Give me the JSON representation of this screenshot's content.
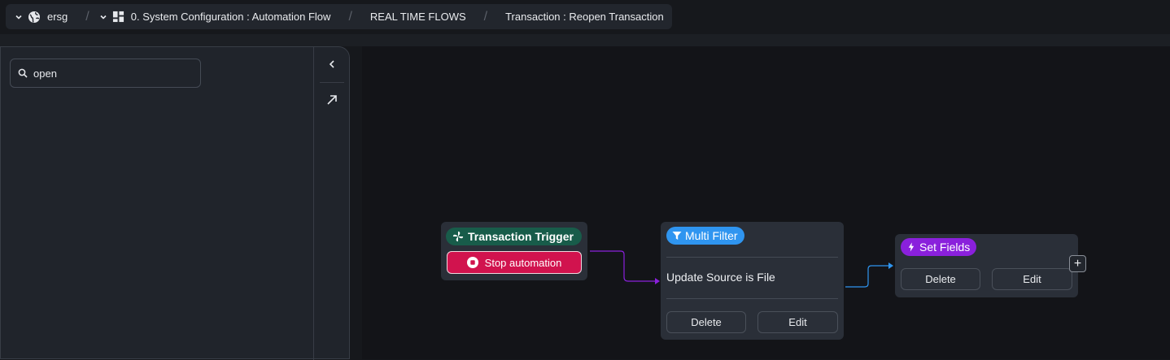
{
  "breadcrumb": {
    "workspace": "ersg",
    "project": "0. System Configuration : Automation Flow",
    "section": "REAL TIME FLOWS",
    "flow": "Transaction : Reopen Transaction",
    "separator": "/"
  },
  "sidebar": {
    "search_value": "open",
    "icons": [
      "search-icon",
      "collapse-left-icon",
      "open-external-icon"
    ]
  },
  "flow": {
    "trigger": {
      "title": "Transaction Trigger",
      "icon": "pinwheel-icon",
      "stop_label": "Stop automation",
      "color": "#185c4a",
      "stop_color": "#d1134e"
    },
    "filter": {
      "title": "Multi Filter",
      "icon": "filter-icon",
      "condition": "Update Source is File",
      "delete_label": "Delete",
      "edit_label": "Edit",
      "color": "#2f95f0"
    },
    "set_fields": {
      "title": "Set Fields",
      "icon": "bolt-icon",
      "delete_label": "Delete",
      "edit_label": "Edit",
      "add_label": "+",
      "color": "#8a20dc"
    }
  }
}
